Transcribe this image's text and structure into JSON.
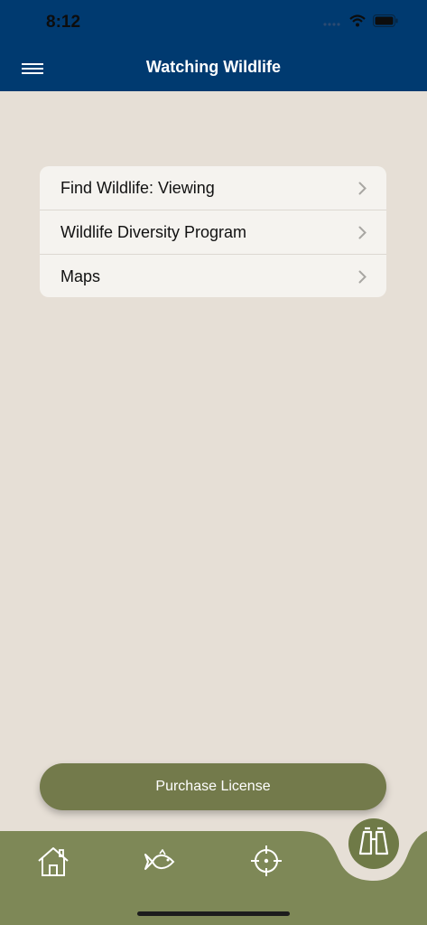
{
  "status": {
    "time": "8:12"
  },
  "header": {
    "title": "Watching Wildlife"
  },
  "menu": {
    "items": [
      {
        "label": "Find Wildlife: Viewing"
      },
      {
        "label": "Wildlife Diversity Program"
      },
      {
        "label": "Maps"
      }
    ]
  },
  "purchase": {
    "label": "Purchase License"
  },
  "tabs": [
    {
      "icon": "home-icon"
    },
    {
      "icon": "fish-icon"
    },
    {
      "icon": "crosshair-icon"
    },
    {
      "icon": "binoculars-icon",
      "active": true
    }
  ],
  "colors": {
    "header": "#003a70",
    "background": "#e6dfd6",
    "accent": "#737a4b",
    "tabbar": "#7e8857"
  }
}
